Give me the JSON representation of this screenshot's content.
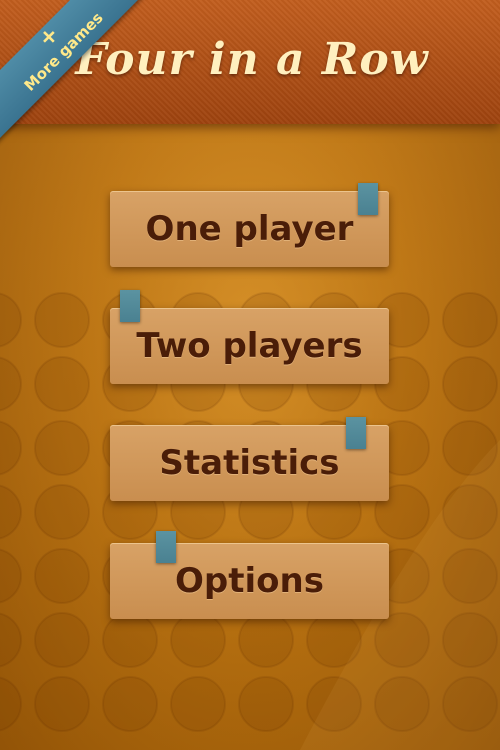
{
  "header": {
    "title": "Four in a Row"
  },
  "ribbon": {
    "plus": "+",
    "label": "More games",
    "color": "#4a87a2",
    "text_color": "#ffe98a"
  },
  "menu": {
    "items": [
      {
        "id": "one-player",
        "label": "One player"
      },
      {
        "id": "two-players",
        "label": "Two players"
      },
      {
        "id": "statistics",
        "label": "Statistics"
      },
      {
        "id": "options",
        "label": "Options"
      }
    ]
  },
  "colors": {
    "header": "#b04f17",
    "background": "#b9720f",
    "button": "#d19856",
    "button_text": "#4a1d08",
    "tag": "#5489a0",
    "title": "#fff0bf"
  }
}
